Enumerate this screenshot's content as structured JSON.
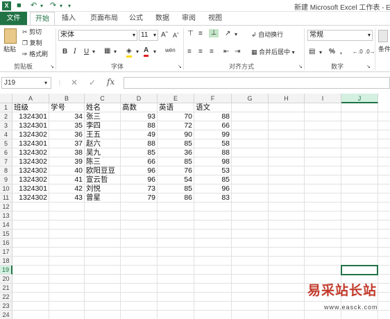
{
  "window": {
    "app_icon": "X",
    "title": "新建 Microsoft Excel 工作表 - Exce"
  },
  "tabs": [
    "文件",
    "开始",
    "插入",
    "页面布局",
    "公式",
    "数据",
    "审阅",
    "视图"
  ],
  "ribbon": {
    "clipboard": {
      "paste": "粘贴",
      "cut": "剪切",
      "copy": "复制",
      "format_painter": "格式刷",
      "label": "剪贴板"
    },
    "font": {
      "name": "宋体",
      "size": "11",
      "bold": "B",
      "italic": "I",
      "underline": "U",
      "label": "字体"
    },
    "alignment": {
      "wrap_text": "自动换行",
      "merge_center": "合并后居中",
      "label": "对齐方式"
    },
    "number": {
      "format": "常规",
      "percent": "%",
      "comma": ",",
      "label": "数字"
    },
    "styles": {
      "conditional": "条件"
    }
  },
  "formula_bar": {
    "name_box": "J19",
    "cancel": "✕",
    "enter": "✓",
    "fx": "fx",
    "value": ""
  },
  "columns": [
    "A",
    "B",
    "C",
    "D",
    "E",
    "F",
    "G",
    "H",
    "I",
    "J"
  ],
  "selected_column": "J",
  "selected_row": "19",
  "rows": [
    "1",
    "2",
    "3",
    "4",
    "5",
    "6",
    "7",
    "8",
    "9",
    "10",
    "11",
    "12",
    "13",
    "14",
    "15",
    "16",
    "17",
    "18",
    "19",
    "20",
    "21",
    "22",
    "23",
    "24"
  ],
  "header_row": [
    "班级",
    "学号",
    "姓名",
    "高数",
    "英语",
    "语文"
  ],
  "data_rows": [
    [
      "1324301",
      "34",
      "张三",
      "93",
      "70",
      "88"
    ],
    [
      "1324301",
      "35",
      "李四",
      "88",
      "72",
      "66"
    ],
    [
      "1324302",
      "36",
      "王五",
      "49",
      "90",
      "99"
    ],
    [
      "1324301",
      "37",
      "赵六",
      "88",
      "85",
      "58"
    ],
    [
      "1324302",
      "38",
      "吴九",
      "85",
      "36",
      "88"
    ],
    [
      "1324302",
      "39",
      "陈三",
      "66",
      "85",
      "98"
    ],
    [
      "1324302",
      "40",
      "欧阳豆豆",
      "96",
      "76",
      "53"
    ],
    [
      "1324302",
      "41",
      "宣云哲",
      "96",
      "54",
      "85"
    ],
    [
      "1324301",
      "42",
      "刘悦",
      "73",
      "85",
      "96"
    ],
    [
      "1324302",
      "43",
      "曾星",
      "79",
      "86",
      "83"
    ]
  ],
  "watermark": {
    "name": "易采站长站",
    "url": "www.easck.com"
  },
  "colors": {
    "accent": "#217346",
    "watermark": "#c23a2c"
  }
}
